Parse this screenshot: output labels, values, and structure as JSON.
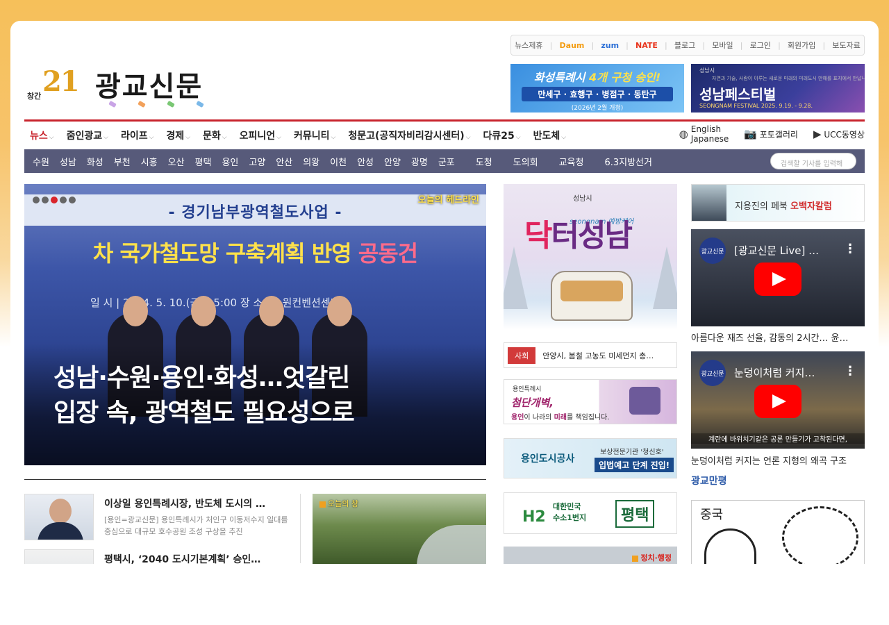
{
  "util": {
    "items": [
      "뉴스제휴",
      "Daum",
      "zum",
      "NATE",
      "블로그",
      "모바일",
      "로그인",
      "회원가입",
      "보도자료"
    ]
  },
  "logo": {
    "anniv": "창간",
    "num": "21",
    "name": "광교신문",
    "dots": [
      "#c9a4e6",
      "#f2a15b",
      "#7ac774",
      "#7ab8e8"
    ]
  },
  "banner1": {
    "line1": "화성특례시 ",
    "line1b": "4개 구청 승인!",
    "line2": "만세구 · 효행구 · 병점구 · 동탄구",
    "line3": "(2026년 2월 개청)"
  },
  "banner2": {
    "org": "성남시",
    "tag": "자연과 기술, 사람이 이루는 새로운 미래의 미래도시 만해를 표지에서 만납니다",
    "title": "성남페스티벌",
    "sub": "SEONGNAM FESTIVAL 2025. 9.19. - 9.28."
  },
  "nav": {
    "items": [
      "뉴스",
      "줌인광교",
      "라이프",
      "경제",
      "문화",
      "오피니언",
      "커뮤니티",
      "청문고(공직자비리감시센터)",
      "다큐25",
      "반도체"
    ],
    "right": {
      "english": "English",
      "japanese": "Japanese",
      "photo": "포토갤러리",
      "ucc": "UCC동영상"
    }
  },
  "subnav": {
    "items": [
      "수원",
      "성남",
      "화성",
      "부천",
      "시흥",
      "오산",
      "평택",
      "용인",
      "고양",
      "안산",
      "의왕",
      "이천",
      "안성",
      "안양",
      "광명",
      "군포",
      "도청",
      "도의회",
      "교육청",
      "6.3지방선거"
    ],
    "search_placeholder": "검색할 기사를 입력해"
  },
  "hero": {
    "tag": "오늘의 헤드라인",
    "banner_top": "- 경기남부광역철도사업 -",
    "banner_mid_a": "차 국가철도망 구축계획 반영 ",
    "banner_mid_b": "공동건",
    "banner_date": "일 시 |  2024. 5. 10.(금) 15:00        장 소 | 수원컨벤션센터",
    "title_l1": "성남·수원·용인·화성…엇갈린",
    "title_l2": "입장 속, 광역철도 필요성으로",
    "slide_count": 5,
    "slide_active": 3
  },
  "news": [
    {
      "title": "이상일 용인특례시장, 반도체 도시의 …",
      "desc": "[용인=광교신문] 용인특례시가 처인구 이동저수지 일대를 중심으로 대규모 호수공원 조성 구상을 추진"
    },
    {
      "title": "평택시, ‘2040 도시기본계획’ 승인…",
      "desc": ""
    }
  ],
  "today_photo": {
    "label": "오늘의 창"
  },
  "middle": {
    "fest": {
      "org": "성남시",
      "brand": "seongnam 예방케어",
      "title_a": "닥",
      "title_b": "터성남"
    },
    "hot": {
      "tag": "사회",
      "text": "안양시, 봄철 고농도 미세먼지 총…"
    },
    "ad1": {
      "org": "용인특례시",
      "slogan": "첨단개벽,",
      "line_a": "용인",
      "line_b": "이 나라의 ",
      "line_c": "미래",
      "line_d": "를 책임집니다."
    },
    "ad2": {
      "name": "용인도시공사",
      "sub": "보상전문기관 '청신호'",
      "cta": "입법예고 단계 진입!"
    },
    "ad3": {
      "h2": "H2",
      "l1": "대한민국",
      "l2": "수소1번지",
      "city": "평택"
    },
    "ad4": {
      "label": "정치·행정"
    }
  },
  "right": {
    "column": {
      "name": "지용진의 페북 ",
      "tag": "오백자칼럼"
    },
    "video1": {
      "channel": "광교신문",
      "title": "[광교신문 Live] …",
      "caption": "아름다운 재즈 선율, 감동의 2시간… 윤…"
    },
    "video2": {
      "channel": "광교신문",
      "title": "눈덩이처럼 커지…",
      "sub": "계란에 바위치기같은 공론 만들기가 고착된다면,",
      "caption": "눈덩이처럼 커지는 언론 지형의 왜곡 구조"
    },
    "cartoon": {
      "section": "광교만평",
      "title": "중국"
    }
  }
}
